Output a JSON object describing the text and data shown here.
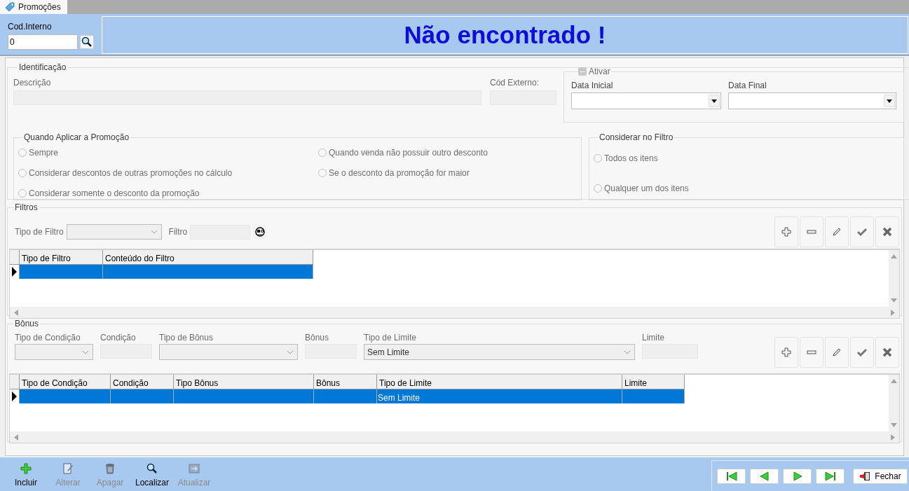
{
  "tab": {
    "label": "Promoções",
    "selected": true
  },
  "header": {
    "cod_interno": {
      "label": "Cod.Interno",
      "value": "0"
    },
    "message": "Não encontrado !"
  },
  "identificacao": {
    "title": "Identificação",
    "descricao": {
      "label": "Descrição",
      "disabled": true
    },
    "cod_externo": {
      "label": "Cód Externo:",
      "disabled": true
    },
    "ativar": {
      "label": "Ativar",
      "indeterminate": true,
      "data_inicial": {
        "label": "Data Inicial"
      },
      "data_final": {
        "label": "Data Final"
      }
    },
    "quando_aplicar": {
      "title": "Quando Aplicar a Promoção",
      "options": [
        {
          "label": "Sempre",
          "selected": false,
          "disabled": true
        },
        {
          "label": "Quando venda não possuir outro desconto",
          "selected": false,
          "disabled": true
        },
        {
          "label": "Considerar descontos de outras promoções no cálculo",
          "selected": false,
          "disabled": true
        },
        {
          "label": "Se o desconto da promoção for maior",
          "selected": false,
          "disabled": true
        },
        {
          "label": "Considerar somente o desconto da promoção",
          "selected": false,
          "disabled": true
        }
      ]
    },
    "considerar_filtro": {
      "title": "Considerar no Filtro",
      "options": [
        {
          "label": "Todos os itens",
          "selected": false,
          "disabled": true
        },
        {
          "label": "Qualquer um dos itens",
          "selected": false,
          "disabled": true
        }
      ]
    }
  },
  "filtros": {
    "title": "Filtros",
    "tipo_label": "Tipo de Filtro",
    "filtro_label": "Filtro",
    "columns": [
      "Tipo de Filtro",
      "Conteúdo do Filtro"
    ],
    "rows": [
      {
        "selected": true,
        "cells": [
          null,
          null
        ]
      }
    ]
  },
  "bonus": {
    "title": "Bônus",
    "fields": [
      {
        "kind": "combo",
        "label": "Tipo de Condição"
      },
      {
        "kind": "field",
        "label": "Condição"
      },
      {
        "kind": "combo",
        "label": "Tipo de Bônus"
      },
      {
        "kind": "field",
        "label": "Bônus"
      },
      {
        "kind": "combo",
        "label": "Tipo de Limite",
        "value": "Sem Limite"
      },
      {
        "kind": "field",
        "label": "Limite"
      }
    ],
    "columns": [
      "Tipo de Condição",
      "Condição",
      "Tipo Bônus",
      "Bônus",
      "Tipo de Limite",
      "Limite"
    ],
    "rows": [
      {
        "selected": true,
        "cells": [
          null,
          null,
          null,
          null,
          "Sem Limite",
          null
        ]
      }
    ]
  },
  "toolbar": [
    {
      "label": "Incluir",
      "disabled": false
    },
    {
      "label": "Alterar",
      "disabled": true
    },
    {
      "label": "Apagar",
      "disabled": true
    },
    {
      "label": "Localizar",
      "disabled": false
    },
    {
      "label": "Atualizar",
      "disabled": true
    }
  ],
  "close_button": {
    "label": "Fechar"
  }
}
